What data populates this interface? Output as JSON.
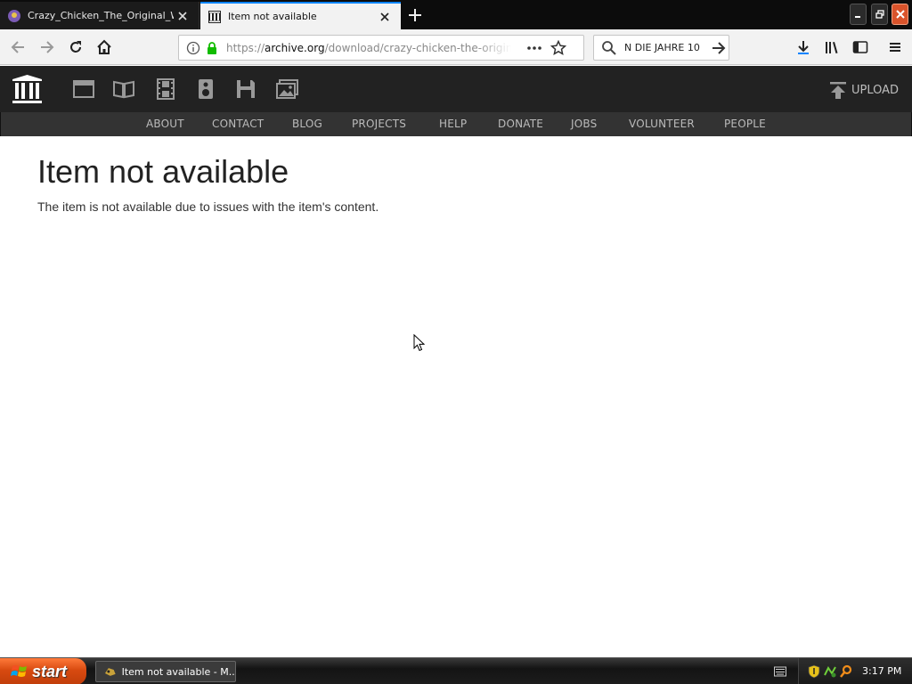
{
  "tabs": [
    {
      "title": "Crazy_Chicken_The_Original_Win",
      "active": false
    },
    {
      "title": "Item not available",
      "active": true
    }
  ],
  "navbar": {
    "url_prefix": "https://",
    "url_host": "archive.org",
    "url_path": "/download/crazy-chicken-the-original-windows",
    "search_query": "N DIE JAHRE 10"
  },
  "ia_nav": {
    "upload_label": "UPLOAD",
    "media_icons": [
      "web-icon",
      "texts-icon",
      "video-icon",
      "audio-icon",
      "software-icon",
      "images-icon"
    ],
    "links": [
      "ABOUT",
      "CONTACT",
      "BLOG",
      "PROJECTS",
      "HELP",
      "DONATE",
      "JOBS",
      "VOLUNTEER",
      "PEOPLE"
    ]
  },
  "content": {
    "heading": "Item not available",
    "message": "The item is not available due to issues with the item's content."
  },
  "taskbar": {
    "start_label": "start",
    "task_title": "Item not available - M...",
    "clock": "3:17 PM"
  },
  "colors": {
    "ia_bar": "#222222",
    "ia_subbar": "#333333",
    "tab_accent": "#0a84ff",
    "lock_green": "#12bc00",
    "start_orange": "#d84a10"
  }
}
